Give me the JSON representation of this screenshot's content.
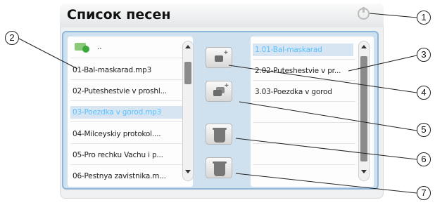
{
  "window": {
    "title": "Список песен"
  },
  "left_list": {
    "folder_label": "..",
    "items": [
      {
        "label": "01-Bal-maskarad.mp3",
        "selected": false
      },
      {
        "label": "02-Puteshestvie v proshl...",
        "selected": false
      },
      {
        "label": "03-Poezdka v gorod.mp3",
        "selected": true
      },
      {
        "label": "04-Milceyskiy protokol....",
        "selected": false
      },
      {
        "label": "05-Pro rechku Vachu i p...",
        "selected": false
      },
      {
        "label": "06-Pestnya zavistnika.m...",
        "selected": false
      }
    ]
  },
  "right_list": {
    "items": [
      {
        "label": "1.01-Bal-maskarad",
        "selected": true
      },
      {
        "label": "2.02-Puteshestvie v pr...",
        "selected": false
      },
      {
        "label": "3.03-Poezdka v gorod",
        "selected": false
      }
    ]
  },
  "callouts": [
    "1",
    "2",
    "3",
    "4",
    "5",
    "6",
    "7"
  ],
  "colors": {
    "selection_text": "#58c2ff",
    "panel_border": "#8fb6d8"
  }
}
